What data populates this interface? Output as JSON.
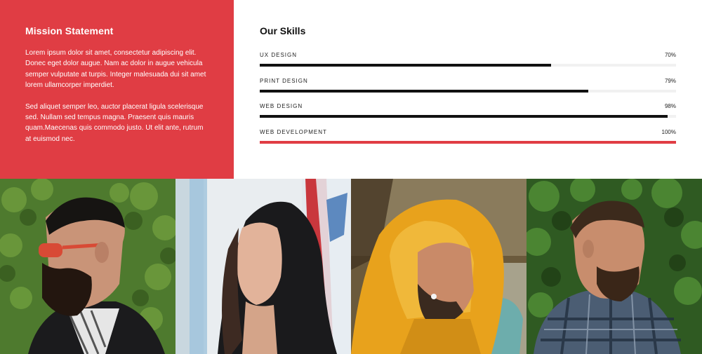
{
  "mission": {
    "title": "Mission Statement",
    "paragraphs": [
      "Lorem ipsum dolor sit amet, consectetur adipiscing elit. Donec eget dolor augue. Nam ac dolor in augue vehicula semper vulputate at turpis. Integer malesuada dui sit amet lorem ullamcorper imperdiet.",
      "Sed aliquet semper leo, auctor placerat ligula scelerisque sed. Nullam sed tempus magna. Praesent quis mauris quam.Maecenas quis commodo justo. Ut elit ante, rutrum at euismod nec."
    ]
  },
  "skills": {
    "title": "Our Skills",
    "items": [
      {
        "name": "UX DESIGN",
        "percent_label": "70%",
        "value": 0.7,
        "color": "#111111"
      },
      {
        "name": "PRINT DESIGN",
        "percent_label": "79%",
        "value": 0.79,
        "color": "#111111"
      },
      {
        "name": "WEB DESIGN",
        "percent_label": "98%",
        "value": 0.98,
        "color": "#111111"
      },
      {
        "name": "WEB DEVELOPMENT",
        "percent_label": "100%",
        "value": 1.0,
        "color": "#e03d44"
      }
    ]
  },
  "colors": {
    "accent": "#e03d44",
    "bar": "#111111",
    "track": "#f1f1f1"
  },
  "team_photos": [
    {
      "name": "photo-man-sunglasses"
    },
    {
      "name": "photo-woman-hood"
    },
    {
      "name": "photo-man-yellow-hood"
    },
    {
      "name": "photo-man-plaid"
    }
  ]
}
